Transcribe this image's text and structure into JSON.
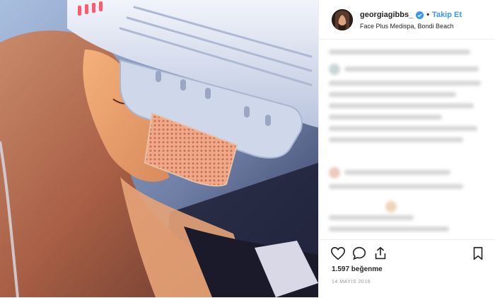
{
  "post": {
    "username": "georgiagibbs_",
    "separator": "•",
    "follow_label": "Takip Et",
    "location": "Face Plus Medispa, Bondi Beach",
    "likes": "1.597 beğenme",
    "date": "14 MAYIS 2016"
  },
  "icons": {
    "like": "heart-icon",
    "comment": "comment-icon",
    "share": "share-icon",
    "save": "bookmark-icon",
    "verified": "verified-badge-icon"
  },
  "colors": {
    "follow": "#3897f0",
    "verified": "#3897f0",
    "text": "#262626",
    "muted": "#999999"
  }
}
